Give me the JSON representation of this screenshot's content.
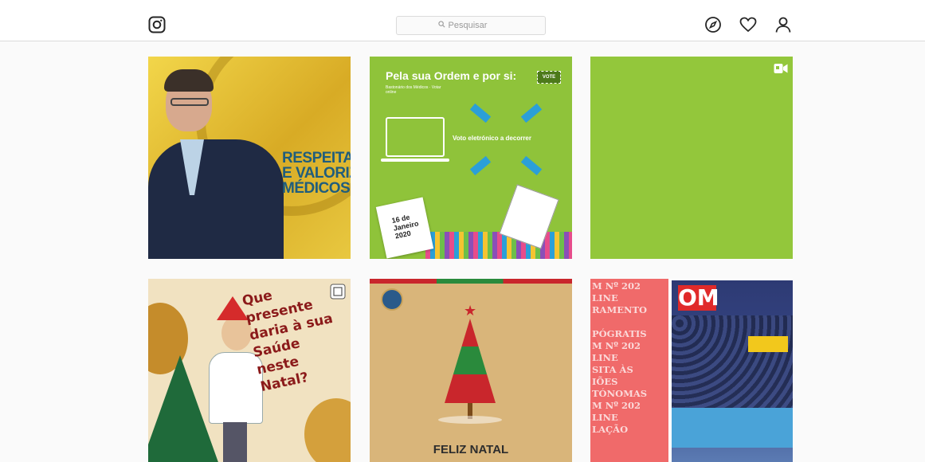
{
  "app": "Instagram",
  "header": {
    "search_placeholder": "Pesquisar",
    "icons": [
      "instagram-logo-icon",
      "search-icon",
      "compass-icon",
      "heart-icon",
      "profile-icon"
    ]
  },
  "posts": [
    {
      "id": "p1",
      "text_lines": [
        "RESPEITAR",
        "E VALORIZAR",
        "MÉDICOS"
      ]
    },
    {
      "id": "p2",
      "title": "Pela sua Ordem e por si:",
      "badge": "VOTE",
      "subtitle": "Bastonário dos Médicos · Votar online",
      "vote_text": "Voto eletrónico a decorrer",
      "calendar_text": "16 de Janeiro 2020"
    },
    {
      "id": "p3",
      "type": "video",
      "icon": "video-camera-icon"
    },
    {
      "id": "p4",
      "text_lines": [
        "Que",
        "presente",
        "daria à sua",
        "Saúde",
        "neste",
        "Natal?"
      ]
    },
    {
      "id": "p5",
      "caption": "FELIZ NATAL"
    },
    {
      "id": "p6",
      "lines": [
        "M Nº 202",
        "LINE",
        "RAMENTO",
        "",
        "PÓGRATIS",
        "M Nº 202",
        "LINE",
        "SITA ÀS",
        "IÕES",
        "TÓNOMAS",
        "M Nº 202",
        "LINE",
        "LAÇÃO"
      ],
      "magazine_logo": "OM"
    }
  ]
}
